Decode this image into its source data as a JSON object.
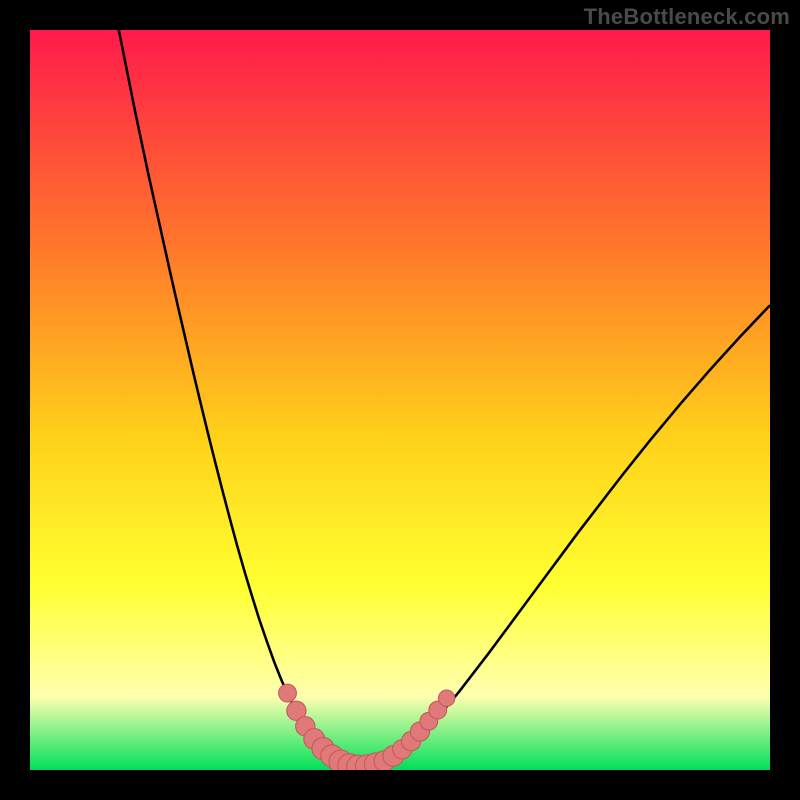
{
  "attribution": "TheBottleneck.com",
  "colors": {
    "frame_bg": "#000000",
    "gradient_top": "#ff1a4b",
    "gradient_mid1": "#ff7a2a",
    "gradient_mid2": "#ffd11a",
    "gradient_mid3": "#ffff30",
    "gradient_pale": "#ffffb0",
    "gradient_bottom": "#00e05a",
    "curve": "#000000",
    "marker_fill": "#e07a7a",
    "marker_stroke": "#c55a5a"
  },
  "chart_data": {
    "type": "line",
    "title": "",
    "xlabel": "",
    "ylabel": "",
    "xlim": [
      0,
      100
    ],
    "ylim": [
      0,
      100
    ],
    "curve": {
      "x": [
        12,
        13,
        14,
        15,
        16,
        17,
        18,
        19,
        20,
        21,
        22,
        23,
        24,
        25,
        26,
        27,
        28,
        29,
        30,
        31,
        32,
        33,
        34,
        35,
        36,
        37,
        38,
        39,
        40,
        41,
        42,
        43,
        43.5,
        44,
        45,
        46,
        47,
        48,
        49,
        50,
        52,
        54,
        56,
        58,
        60,
        62,
        64,
        66,
        68,
        70,
        72,
        74,
        76,
        78,
        80,
        82,
        84,
        86,
        88,
        90,
        92,
        94,
        96,
        98,
        100
      ],
      "y": [
        100,
        95,
        90,
        85.2,
        80.5,
        76,
        71.5,
        67,
        62.6,
        58.3,
        54,
        49.8,
        45.7,
        41.7,
        37.8,
        34,
        30.3,
        26.8,
        23.5,
        20.3,
        17.4,
        14.6,
        12.1,
        9.9,
        7.9,
        6.2,
        4.8,
        3.6,
        2.6,
        1.8,
        1.2,
        0.7,
        0.55,
        0.5,
        0.5,
        0.55,
        0.7,
        1.0,
        1.5,
        2.2,
        3.9,
        5.9,
        8.2,
        10.6,
        13.2,
        15.8,
        18.5,
        21.2,
        23.9,
        26.6,
        29.3,
        32,
        34.6,
        37.2,
        39.8,
        42.3,
        44.8,
        47.2,
        49.6,
        51.9,
        54.2,
        56.4,
        58.6,
        60.7,
        62.8
      ]
    },
    "markers": [
      {
        "x": 34.8,
        "y": 10.4,
        "r": 1.2
      },
      {
        "x": 36.0,
        "y": 8.0,
        "r": 1.3
      },
      {
        "x": 37.2,
        "y": 5.9,
        "r": 1.3
      },
      {
        "x": 38.4,
        "y": 4.2,
        "r": 1.4
      },
      {
        "x": 39.6,
        "y": 2.9,
        "r": 1.5
      },
      {
        "x": 40.8,
        "y": 1.9,
        "r": 1.5
      },
      {
        "x": 42.0,
        "y": 1.1,
        "r": 1.6
      },
      {
        "x": 43.2,
        "y": 0.6,
        "r": 1.6
      },
      {
        "x": 44.3,
        "y": 0.5,
        "r": 1.5
      },
      {
        "x": 45.5,
        "y": 0.55,
        "r": 1.5
      },
      {
        "x": 46.7,
        "y": 0.8,
        "r": 1.5
      },
      {
        "x": 47.9,
        "y": 1.2,
        "r": 1.4
      },
      {
        "x": 49.1,
        "y": 1.9,
        "r": 1.4
      },
      {
        "x": 50.3,
        "y": 2.8,
        "r": 1.3
      },
      {
        "x": 51.5,
        "y": 3.9,
        "r": 1.3
      },
      {
        "x": 52.7,
        "y": 5.2,
        "r": 1.3
      },
      {
        "x": 53.9,
        "y": 6.6,
        "r": 1.2
      },
      {
        "x": 55.1,
        "y": 8.1,
        "r": 1.2
      },
      {
        "x": 56.3,
        "y": 9.7,
        "r": 1.1
      }
    ],
    "gradient_stops": [
      {
        "offset": 0.0,
        "color_key": "gradient_top"
      },
      {
        "offset": 0.3,
        "color_key": "gradient_mid1"
      },
      {
        "offset": 0.55,
        "color_key": "gradient_mid2"
      },
      {
        "offset": 0.75,
        "color_key": "gradient_mid3"
      },
      {
        "offset": 0.9,
        "color_key": "gradient_pale"
      },
      {
        "offset": 1.0,
        "color_key": "gradient_bottom"
      }
    ]
  }
}
